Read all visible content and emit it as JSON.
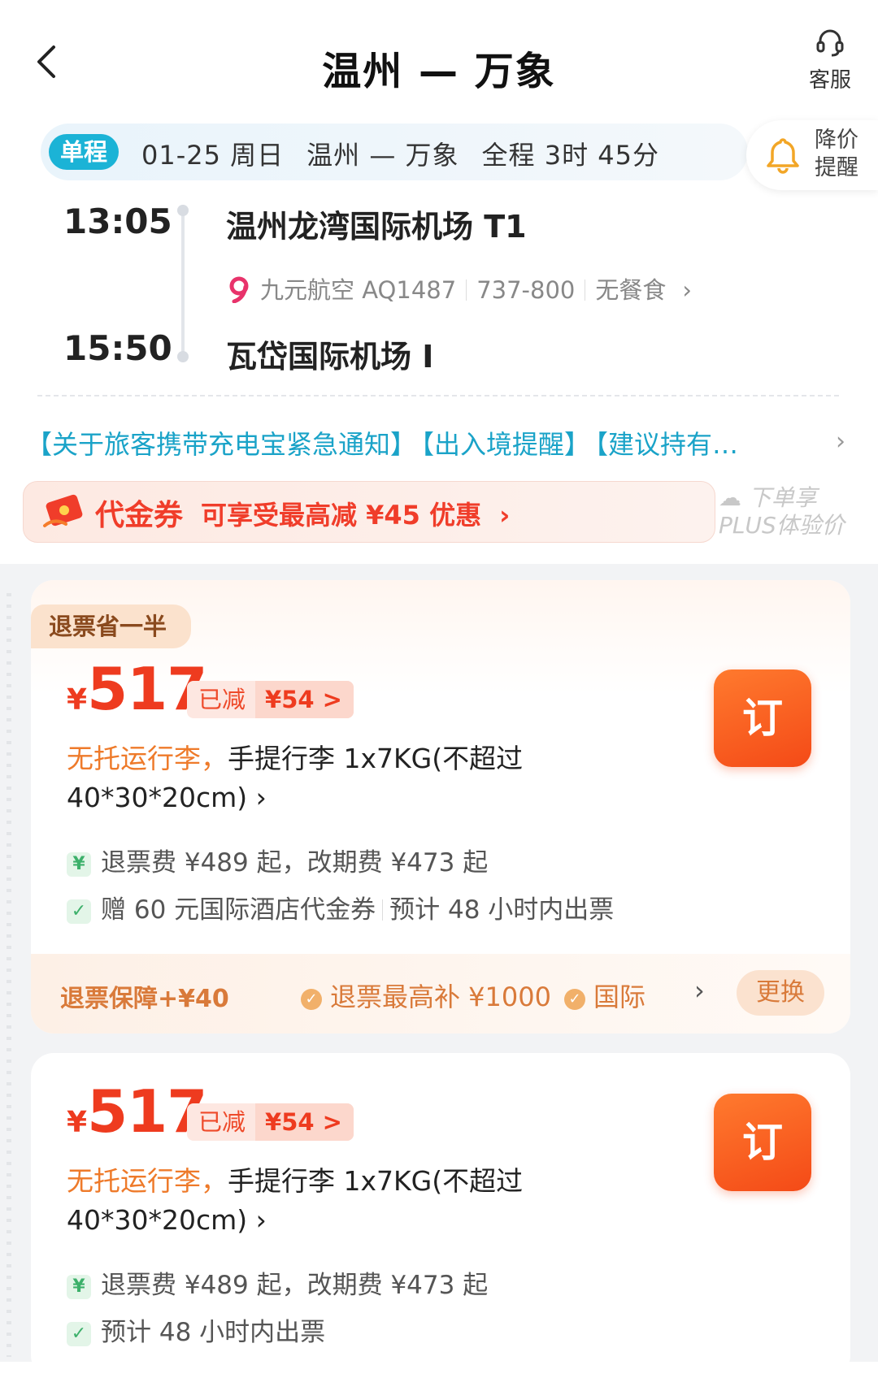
{
  "header": {
    "title": "温州 — 万象",
    "customer_service_label": "客服"
  },
  "summary": {
    "trip_type": "单程",
    "date": "01-25 周日",
    "route": "温州 — 万象",
    "duration": "全程 3时 45分",
    "price_alert_label": "降价提醒"
  },
  "flight": {
    "depart_time": "13:05",
    "depart_airport": "温州龙湾国际机场 T1",
    "airline_flight": "九元航空 AQ1487",
    "aircraft": "737-800",
    "meal": "无餐食",
    "arrive_time": "15:50",
    "arrive_airport": "瓦岱国际机场 I"
  },
  "notices": [
    "【关于旅客携带充电宝紧急通知】",
    "【出入境提醒】",
    "【建议持有…"
  ],
  "coupon": {
    "title": "代金券",
    "text": "可享受最高减 ¥45 优惠",
    "plus_line1": "下单享",
    "plus_line2": "PLUS体验价"
  },
  "offers": [
    {
      "tag": "退票省一半",
      "currency": "¥",
      "price": "517",
      "discount_label": "已减",
      "discount_value": "¥54 >",
      "book_label": "订",
      "baggage_warn": "无托运行李，",
      "baggage_text": "手提行李 1x7KG(不超过40*30*20cm) ›",
      "fees": "退票费 ¥489 起，改期费 ¥473 起",
      "perk1": "赠 60 元国际酒店代金券",
      "perk2": "预计 48 小时内出票",
      "insurance_label": "退票保障+¥40",
      "insurance_item1": "退票最高补 ¥1000",
      "insurance_item2": "国际",
      "change_label": "更换"
    },
    {
      "currency": "¥",
      "price": "517",
      "discount_label": "已减",
      "discount_value": "¥54 >",
      "book_label": "订",
      "baggage_warn": "无托运行李，",
      "baggage_text": "手提行李 1x7KG(不超过40*30*20cm) ›",
      "fees": "退票费 ¥489 起，改期费 ¥473 起",
      "perk1": "预计 48 小时内出票"
    }
  ],
  "colors": {
    "accent_orange": "#ee3b1f",
    "teal": "#1bb3d6",
    "notice_blue": "#1aa3c8"
  }
}
